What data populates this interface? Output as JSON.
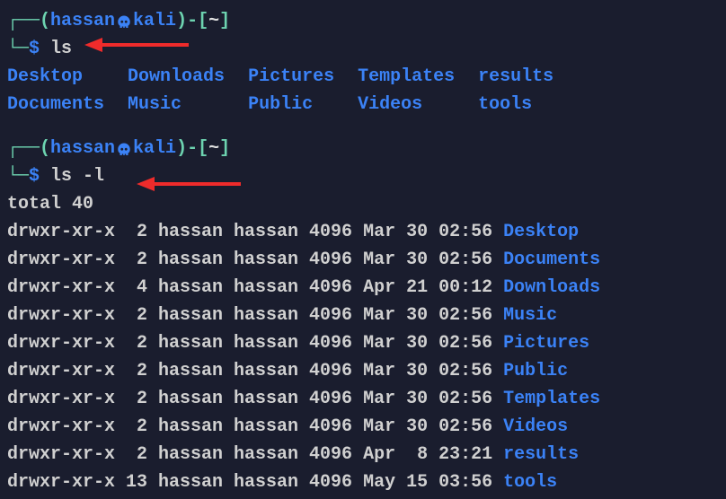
{
  "prompt1": {
    "user": "hassan",
    "host": "kali",
    "path": "~",
    "command": "ls"
  },
  "ls_grid": {
    "r0c0": "Desktop",
    "r0c1": "Downloads",
    "r0c2": "Pictures",
    "r0c3": "Templates",
    "r0c4": "results",
    "r1c0": "Documents",
    "r1c1": "Music",
    "r1c2": "Public",
    "r1c3": "Videos",
    "r1c4": "tools"
  },
  "prompt2": {
    "user": "hassan",
    "host": "kali",
    "path": "~",
    "command": "ls -l"
  },
  "ll": {
    "total": "total 40",
    "rows": [
      {
        "perm": "drwxr-xr-x",
        "links": " 2",
        "owner": "hassan",
        "group": "hassan",
        "size": "4096",
        "date": "Mar 30 02:56",
        "name": "Desktop"
      },
      {
        "perm": "drwxr-xr-x",
        "links": " 2",
        "owner": "hassan",
        "group": "hassan",
        "size": "4096",
        "date": "Mar 30 02:56",
        "name": "Documents"
      },
      {
        "perm": "drwxr-xr-x",
        "links": " 4",
        "owner": "hassan",
        "group": "hassan",
        "size": "4096",
        "date": "Apr 21 00:12",
        "name": "Downloads"
      },
      {
        "perm": "drwxr-xr-x",
        "links": " 2",
        "owner": "hassan",
        "group": "hassan",
        "size": "4096",
        "date": "Mar 30 02:56",
        "name": "Music"
      },
      {
        "perm": "drwxr-xr-x",
        "links": " 2",
        "owner": "hassan",
        "group": "hassan",
        "size": "4096",
        "date": "Mar 30 02:56",
        "name": "Pictures"
      },
      {
        "perm": "drwxr-xr-x",
        "links": " 2",
        "owner": "hassan",
        "group": "hassan",
        "size": "4096",
        "date": "Mar 30 02:56",
        "name": "Public"
      },
      {
        "perm": "drwxr-xr-x",
        "links": " 2",
        "owner": "hassan",
        "group": "hassan",
        "size": "4096",
        "date": "Mar 30 02:56",
        "name": "Templates"
      },
      {
        "perm": "drwxr-xr-x",
        "links": " 2",
        "owner": "hassan",
        "group": "hassan",
        "size": "4096",
        "date": "Mar 30 02:56",
        "name": "Videos"
      },
      {
        "perm": "drwxr-xr-x",
        "links": " 2",
        "owner": "hassan",
        "group": "hassan",
        "size": "4096",
        "date": "Apr  8 23:21",
        "name": "results"
      },
      {
        "perm": "drwxr-xr-x",
        "links": "13",
        "owner": "hassan",
        "group": "hassan",
        "size": "4096",
        "date": "May 15 03:56",
        "name": "tools"
      }
    ]
  },
  "colors": {
    "arrow": "#ef2b2b"
  }
}
